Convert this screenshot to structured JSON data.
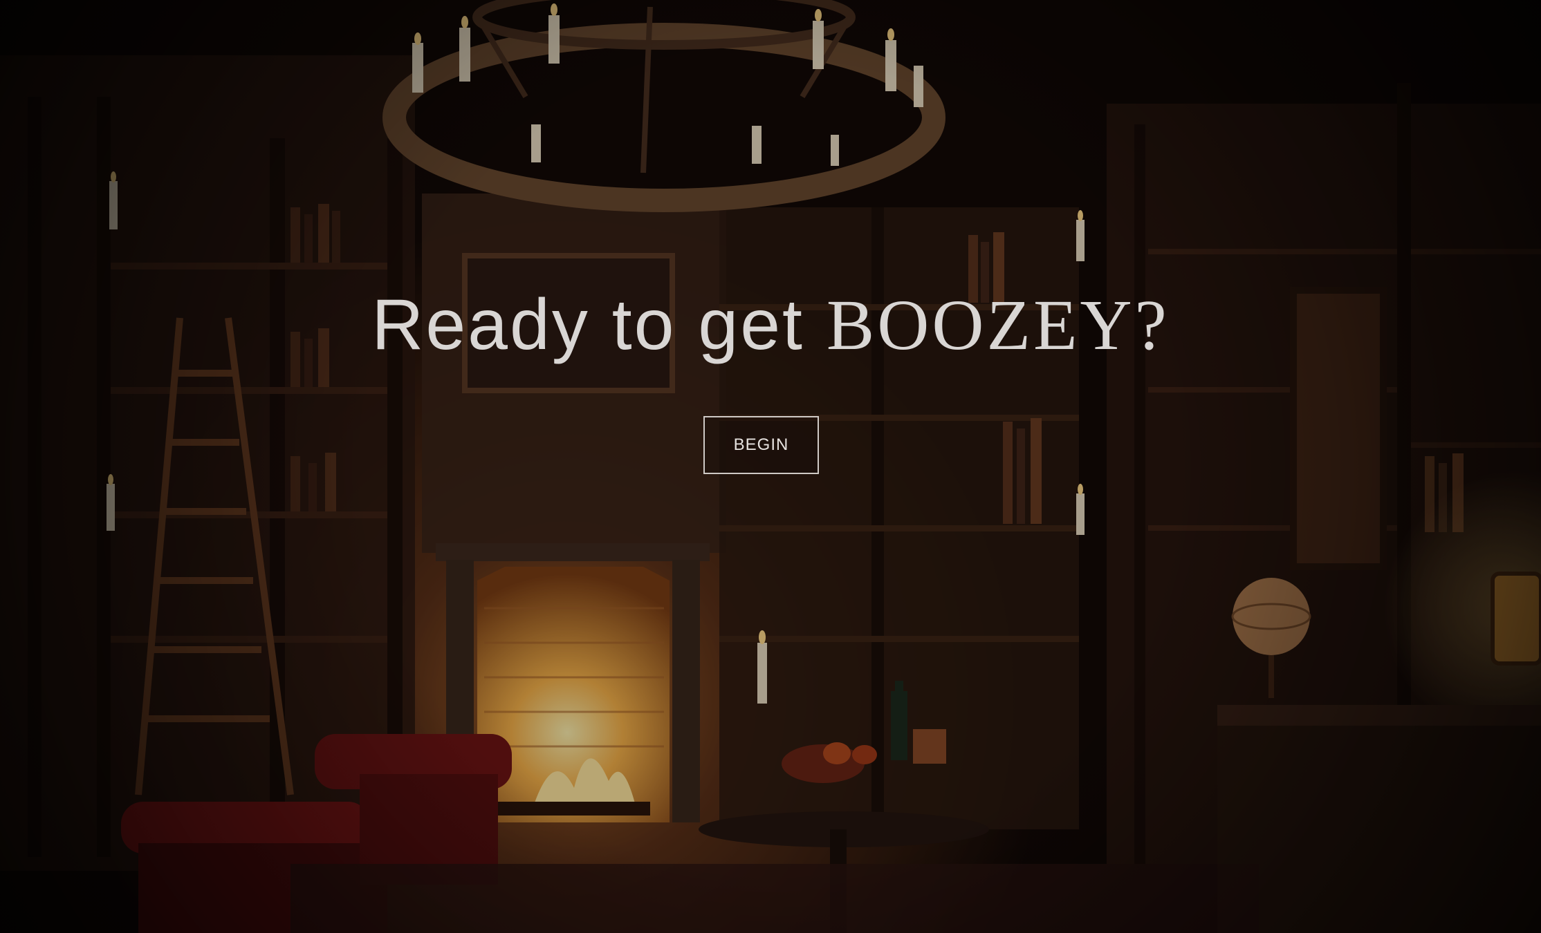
{
  "hero": {
    "headline_prefix": "Ready to get",
    "headline_brand": "BOOZEY?",
    "begin_label": "BEGIN"
  },
  "background": {
    "scene": "candlelit library with fireplace",
    "icons": [
      "chandelier-icon",
      "candle-icon",
      "fireplace-icon",
      "armchair-icon",
      "globe-icon",
      "lantern-icon",
      "wine-bottle-icon",
      "bookshelf-icon",
      "ladder-icon"
    ]
  },
  "colors": {
    "text": "#d9d6d4",
    "button_border": "#cfcac6",
    "fire": "#f0a03a",
    "shadow": "#0d0705"
  }
}
